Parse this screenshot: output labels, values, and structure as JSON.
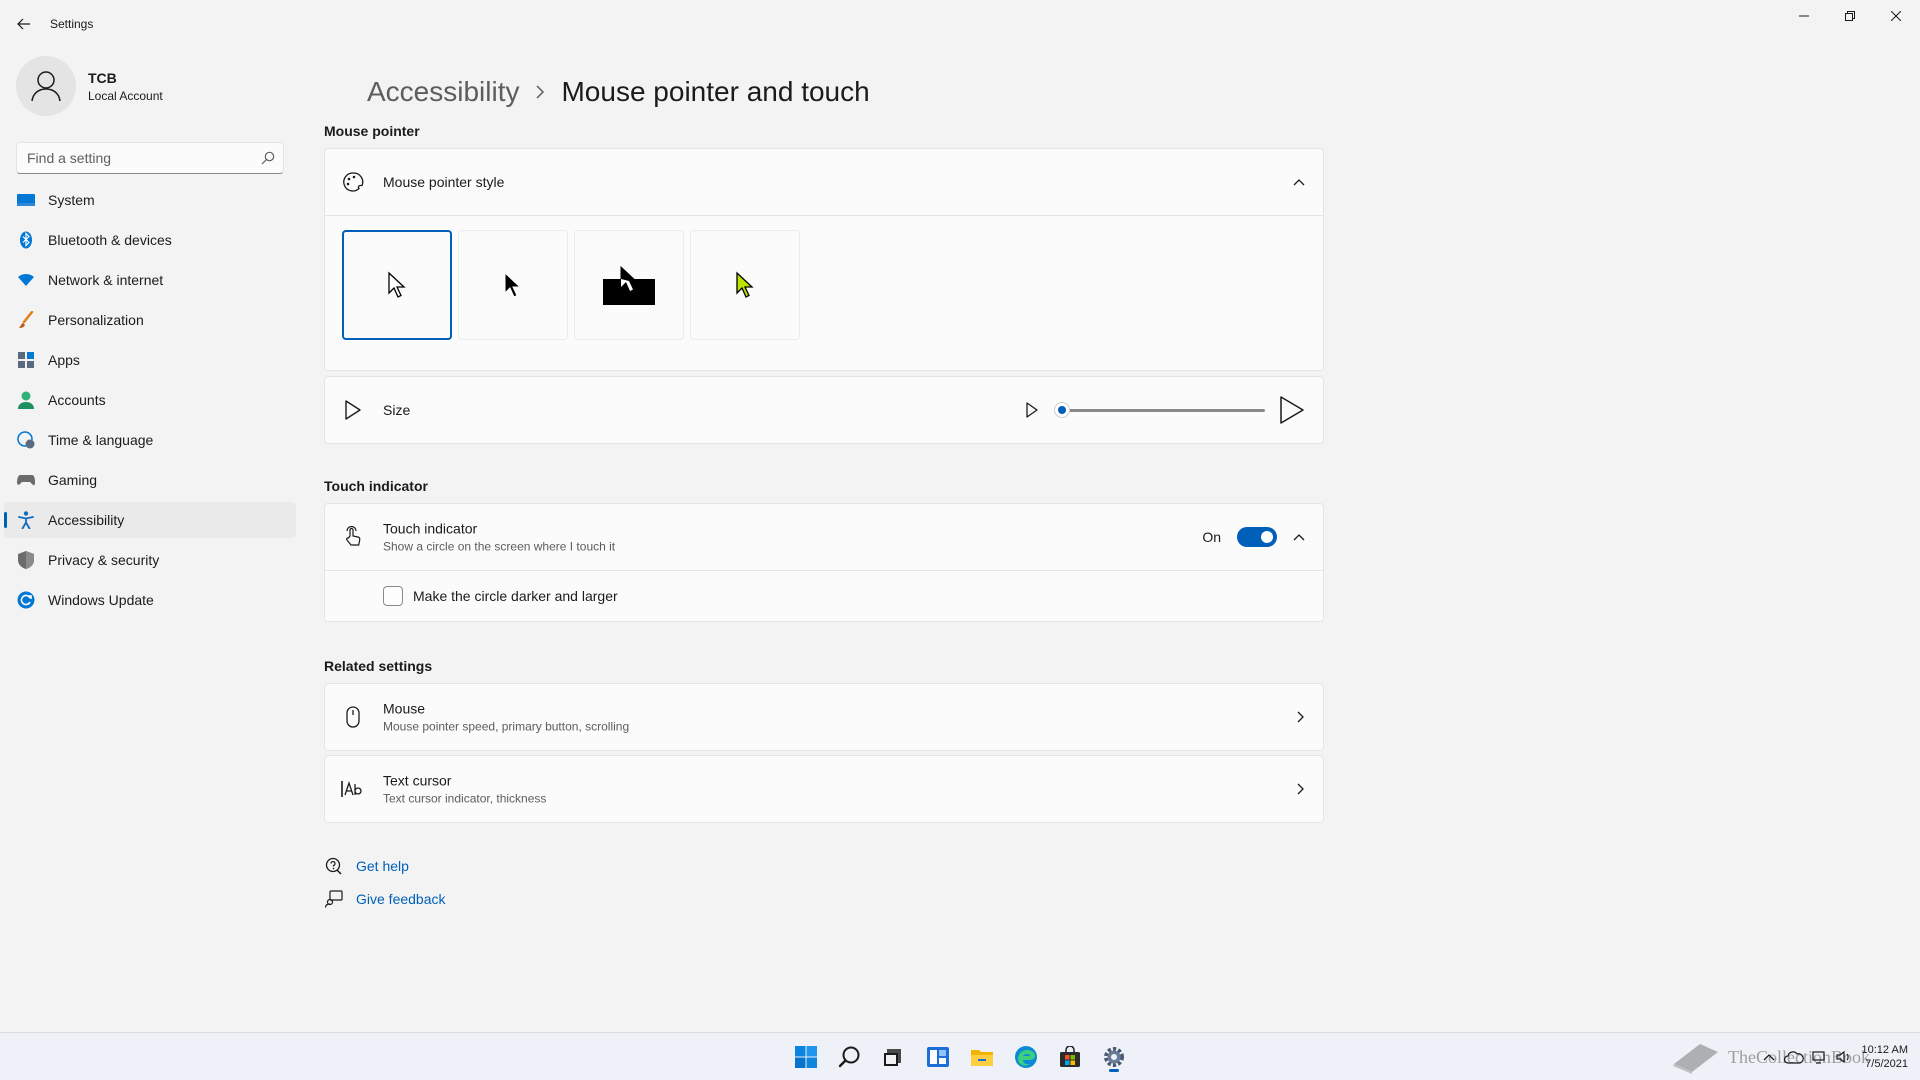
{
  "window": {
    "title": "Settings",
    "back_icon": "back-arrow-icon",
    "controls": [
      "minimize-icon",
      "restore-icon",
      "close-icon"
    ]
  },
  "profile": {
    "name": "TCB",
    "account_type": "Local Account"
  },
  "search": {
    "placeholder": "Find a setting",
    "value": ""
  },
  "sidebar": {
    "items": [
      {
        "label": "System",
        "icon": "system-icon",
        "color": "#0078d4"
      },
      {
        "label": "Bluetooth & devices",
        "icon": "bluetooth-icon",
        "color": "#0078d4"
      },
      {
        "label": "Network & internet",
        "icon": "network-icon",
        "color": "#0078d4"
      },
      {
        "label": "Personalization",
        "icon": "brush-icon",
        "color": "#e37c1a"
      },
      {
        "label": "Apps",
        "icon": "apps-icon",
        "color": "#5b6a7e"
      },
      {
        "label": "Accounts",
        "icon": "accounts-icon",
        "color": "#2fb07a"
      },
      {
        "label": "Time & language",
        "icon": "globe-clock-icon",
        "color": "#0078d4"
      },
      {
        "label": "Gaming",
        "icon": "gamepad-icon",
        "color": "#6b6b6b"
      },
      {
        "label": "Accessibility",
        "icon": "accessibility-icon",
        "color": "#0f6cbd"
      },
      {
        "label": "Privacy & security",
        "icon": "shield-icon",
        "color": "#6b6b6b"
      },
      {
        "label": "Windows Update",
        "icon": "update-icon",
        "color": "#0078d4"
      }
    ],
    "selected": "Accessibility"
  },
  "breadcrumb": {
    "parent": "Accessibility",
    "current": "Mouse pointer and touch"
  },
  "mouse_pointer": {
    "section_title": "Mouse pointer",
    "style_row": {
      "title": "Mouse pointer style",
      "icon": "pointer-style-icon",
      "expanded": true,
      "options": [
        {
          "name": "White",
          "selected": true
        },
        {
          "name": "Black",
          "selected": false
        },
        {
          "name": "Inverted",
          "selected": false
        },
        {
          "name": "Custom",
          "selected": false,
          "color": "#b8e400"
        }
      ]
    },
    "size_row": {
      "title": "Size",
      "icon": "pointer-icon",
      "slider_fraction": 0.0
    }
  },
  "touch": {
    "section_title": "Touch indicator",
    "indicator_row": {
      "title": "Touch indicator",
      "subtitle": "Show a circle on the screen where I touch it",
      "icon": "touch-icon",
      "toggle_label": "On",
      "toggle_on": true
    },
    "darker_option": {
      "label": "Make the circle darker and larger",
      "checked": false
    }
  },
  "related": {
    "section_title": "Related settings",
    "items": [
      {
        "title": "Mouse",
        "subtitle": "Mouse pointer speed, primary button, scrolling",
        "icon": "mouse-icon"
      },
      {
        "title": "Text cursor",
        "subtitle": "Text cursor indicator, thickness",
        "icon": "text-cursor-icon"
      }
    ]
  },
  "help": {
    "get_help": "Get help",
    "give_feedback": "Give feedback"
  },
  "taskbar": {
    "icons": [
      "start-icon",
      "search-icon",
      "task-view-icon",
      "widgets-icon",
      "file-explorer-icon",
      "edge-icon",
      "store-icon",
      "settings-icon"
    ],
    "active": "settings-icon",
    "time": "10:12 AM",
    "date": "7/5/2021",
    "watermark": "TheCollectionBook"
  },
  "colors": {
    "accent": "#005fb8",
    "background": "#f3f3f3",
    "card": "#fbfbfb"
  }
}
